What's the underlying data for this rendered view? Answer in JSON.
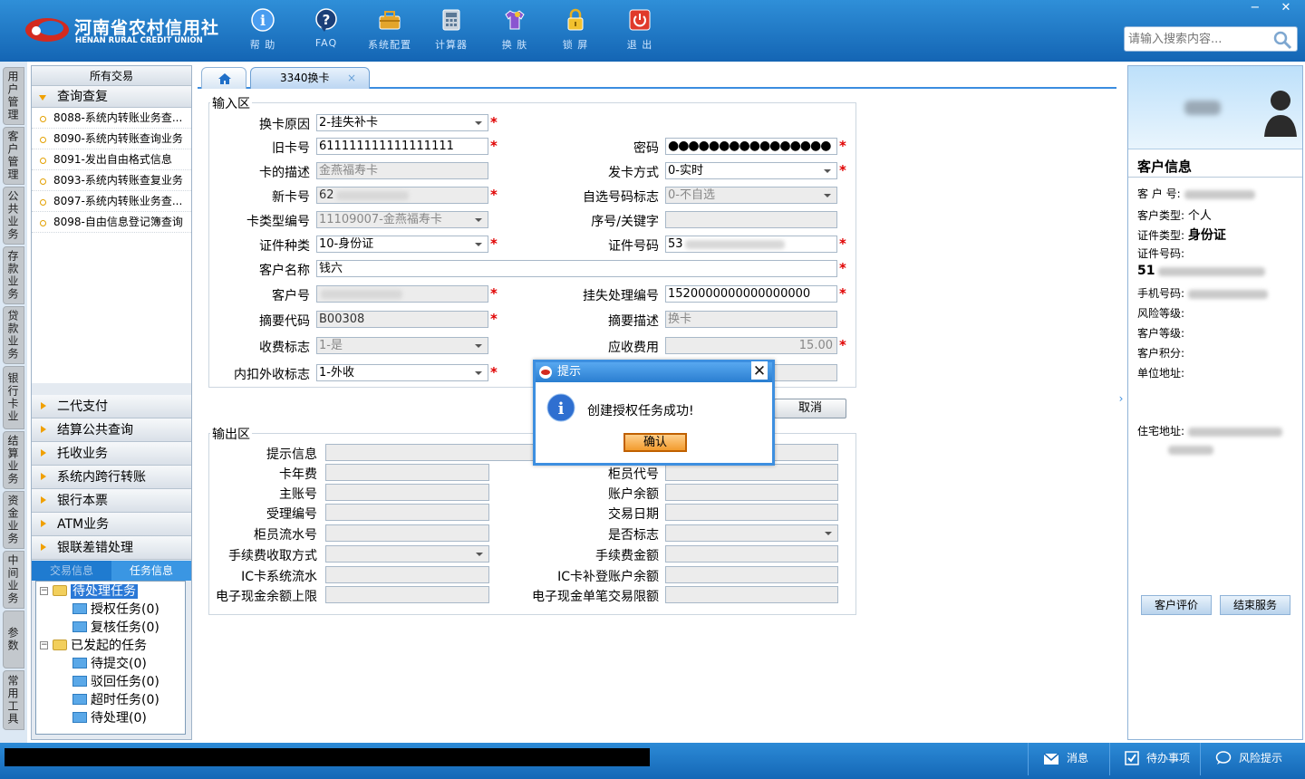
{
  "header": {
    "logo_cn": "河南省农村信用社",
    "logo_en": "HENAN RURAL CREDIT UNION",
    "toolbar": [
      {
        "label": "帮 助",
        "icon": "help-icon"
      },
      {
        "label": "FAQ",
        "icon": "faq-icon"
      },
      {
        "label": "系统配置",
        "icon": "toolbox-icon"
      },
      {
        "label": "计算器",
        "icon": "calculator-icon"
      },
      {
        "label": "换 肤",
        "icon": "tshirt-icon"
      },
      {
        "label": "锁 屏",
        "icon": "lock-icon"
      },
      {
        "label": "退 出",
        "icon": "power-icon"
      }
    ],
    "search_placeholder": "请输入搜索内容...",
    "win_min": "−",
    "win_close": "✕"
  },
  "vertical_tabs": [
    "用户管理",
    "客户管理",
    "公共业务",
    "存款业务",
    "贷款业务",
    "银行卡业务",
    "结算业务",
    "资金业务",
    "中间业务",
    "参数",
    "常用工具"
  ],
  "left_nav": {
    "header": "所有交易",
    "open_group": "查询查复",
    "items": [
      "8088-系统内转账业务查...",
      "8090-系统内转账查询业务",
      "8091-发出自由格式信息",
      "8093-系统内转账查复业务",
      "8097-系统内转账业务查...",
      "8098-自由信息登记簿查询"
    ],
    "groups": [
      "二代支付",
      "结算公共查询",
      "托收业务",
      "系统内跨行转账",
      "银行本票",
      "ATM业务",
      "银联差错处理"
    ],
    "task_tabs": [
      "交易信息",
      "任务信息"
    ],
    "tree": {
      "pending": "待处理任务",
      "pending_children": [
        "授权任务(0)",
        "复核任务(0)"
      ],
      "initiated": "已发起的任务",
      "initiated_children": [
        "待提交(0)",
        "驳回任务(0)",
        "超时任务(0)",
        "待处理(0)"
      ]
    }
  },
  "tabs": {
    "active": "3340换卡",
    "close": "×"
  },
  "input_area": {
    "legend": "输入区",
    "reason_label": "换卡原因",
    "reason_value": "2-挂失补卡",
    "old_card_label": "旧卡号",
    "old_card_value": "611111111111111111",
    "password_label": "密码",
    "password_value": "●●●●●●●●●●●●●●●●",
    "card_desc_label": "卡的描述",
    "card_desc_value": "金燕福寿卡",
    "issue_mode_label": "发卡方式",
    "issue_mode_value": "0-实时",
    "new_card_label": "新卡号",
    "new_card_value": "62",
    "self_select_label": "自选号码标志",
    "self_select_value": "0-不自选",
    "card_type_label": "卡类型编号",
    "card_type_value": "11109007-金燕福寿卡",
    "seq_key_label": "序号/关键字",
    "seq_key_value": "",
    "id_type_label": "证件种类",
    "id_type_value": "10-身份证",
    "id_no_label": "证件号码",
    "id_no_value": "53",
    "cust_name_label": "客户名称",
    "cust_name_value": "钱六",
    "cust_no_label": "客户号",
    "cust_no_value": "",
    "loss_no_label": "挂失处理编号",
    "loss_no_value": "1520000000000000000",
    "abstract_code_label": "摘要代码",
    "abstract_code_value": "B00308",
    "abstract_desc_label": "摘要描述",
    "abstract_desc_value": "换卡",
    "fee_flag_label": "收费标志",
    "fee_flag_value": "1-是",
    "fee_due_label": "应收费用",
    "fee_due_value": "15.00",
    "fee_inout_label": "内扣外收标志",
    "fee_inout_value": "1-外收",
    "required_mark": "*"
  },
  "cancel_button": "取消",
  "output_area": {
    "legend": "输出区",
    "labels": [
      "提示信息",
      "卡年费",
      "柜员代号",
      "主账号",
      "账户余额",
      "受理编号",
      "交易日期",
      "柜员流水号",
      "是否标志",
      "手续费收取方式",
      "手续费金额",
      "IC卡系统流水",
      "IC卡补登账户余额",
      "电子现金余额上限",
      "电子现金单笔交易限额"
    ]
  },
  "dialog": {
    "title": "提示",
    "message": "创建授权任务成功!",
    "ok": "确认",
    "close": "✕"
  },
  "customer": {
    "title": "客户信息",
    "cust_no_label": "客 户 号:",
    "cust_type_label": "客户类型:",
    "cust_type_value": "个人",
    "id_type_label": "证件类型:",
    "id_type_value": "身份证",
    "id_no_label": "证件号码:",
    "id_no_value": "51",
    "phone_label": "手机号码:",
    "risk_label": "风险等级:",
    "level_label": "客户等级:",
    "points_label": "客户积分:",
    "company_label": "单位地址:",
    "home_label": "住宅地址:",
    "eval_button": "客户评价",
    "end_button": "结束服务"
  },
  "status_bar": {
    "messages": "消息",
    "todo": "待办事项",
    "risk": "风险提示"
  },
  "colors": {
    "header": "#1f7bd0",
    "dialog_border": "#3d8fe0",
    "ok_button": "#f29b2e",
    "required": "#e00000"
  }
}
